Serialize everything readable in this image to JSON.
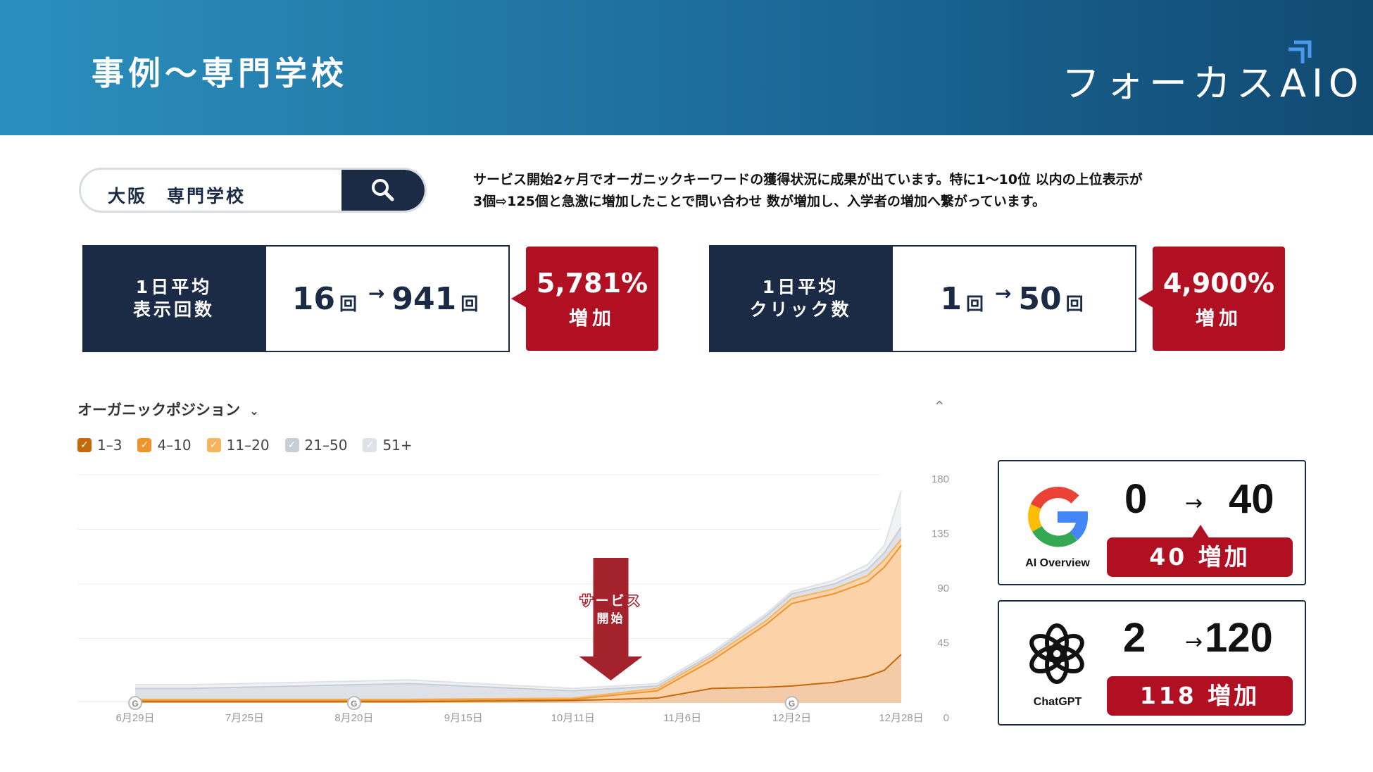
{
  "header": {
    "title": "事例〜専門学校",
    "brand": "フォーカスAIO"
  },
  "search": {
    "query": "大阪　専門学校"
  },
  "intro": {
    "line1": "サービス開始2ヶ月でオーガニックキーワードの獲得状況に成果が出ています。特に1〜10位 以内の上位表示が",
    "line2": "3個⇨125個と急激に増加したことで問い合わせ 数が増加し、入学者の増加へ繋がっています。"
  },
  "kpis": [
    {
      "label_line1": "1日平均",
      "label_line2": "表示回数",
      "from": "16",
      "to": "941",
      "unit": "回",
      "arrow": "→",
      "pct": "5,781%",
      "inc": "増加"
    },
    {
      "label_line1": "1日平均",
      "label_line2": "クリック数",
      "from": "1",
      "to": "50",
      "unit": "回",
      "arrow": "→",
      "pct": "4,900%",
      "inc": "増加"
    }
  ],
  "chart_panel": {
    "title": "オーガニックポジション",
    "dropdown_glyph": "⌄",
    "collapse_glyph": "⌃"
  },
  "legend": [
    {
      "label": "1–3",
      "color": "#c5690b",
      "check": "✓"
    },
    {
      "label": "4–10",
      "color": "#f0932a",
      "check": "✓"
    },
    {
      "label": "11–20",
      "color": "#f6b45c",
      "check": "✓"
    },
    {
      "label": "21–50",
      "color": "#c8cdd6",
      "check": "✓"
    },
    {
      "label": "51+",
      "color": "#dfe2e7",
      "check": "✓"
    }
  ],
  "chart_data": {
    "type": "area",
    "x": [
      "6月29日",
      "7月25日",
      "8月20日",
      "9月15日",
      "10月11日",
      "11月6日",
      "12月2日",
      "12月28日"
    ],
    "ylim": [
      0,
      180
    ],
    "yticks": [
      0,
      45,
      90,
      135,
      180
    ],
    "annotation": {
      "line1": "サービス",
      "line2": "開始",
      "x": "10月20日"
    },
    "google_markers": [
      "6月29日",
      "8月20日",
      "12月2日"
    ],
    "marker_glyph": "G",
    "series": [
      {
        "key": "s1",
        "color": "#c5690b",
        "values": [
          1,
          1,
          1,
          1,
          1,
          1,
          2,
          4,
          12,
          13,
          14,
          17,
          22,
          27,
          40
        ]
      },
      {
        "key": "s4",
        "color": "#f0932a",
        "values": [
          2,
          2,
          2,
          2,
          2,
          2,
          3,
          10,
          35,
          65,
          82,
          90,
          100,
          112,
          130
        ]
      },
      {
        "key": "s11",
        "color": "#f6b45c",
        "values": [
          3,
          3,
          3,
          3,
          3,
          3,
          4,
          12,
          38,
          68,
          86,
          94,
          105,
          118,
          135
        ]
      },
      {
        "key": "s21",
        "color": "#c8cdd6",
        "values": [
          12,
          12,
          13,
          14,
          15,
          16,
          10,
          14,
          40,
          72,
          90,
          98,
          110,
          124,
          145
        ]
      },
      {
        "key": "s51",
        "color": "#dfe2e7",
        "values": [
          15,
          15,
          16,
          17,
          18,
          19,
          12,
          16,
          42,
          74,
          92,
          101,
          114,
          130,
          175
        ]
      }
    ],
    "series_x": [
      "6月29日",
      "7月12日",
      "7月25日",
      "8月7日",
      "8月20日",
      "9月2日",
      "10月11日",
      "10月31日",
      "11月13日",
      "11月26日",
      "12月2日",
      "12月12日",
      "12月20日",
      "12月24日",
      "12月28日"
    ]
  },
  "ai": [
    {
      "name": "AI Overview",
      "from": "0",
      "to": "40",
      "arrow": "→",
      "badge": "40 増加"
    },
    {
      "name": "ChatGPT",
      "from": "2",
      "to": "120",
      "arrow": "→",
      "badge": "118 増加"
    }
  ]
}
